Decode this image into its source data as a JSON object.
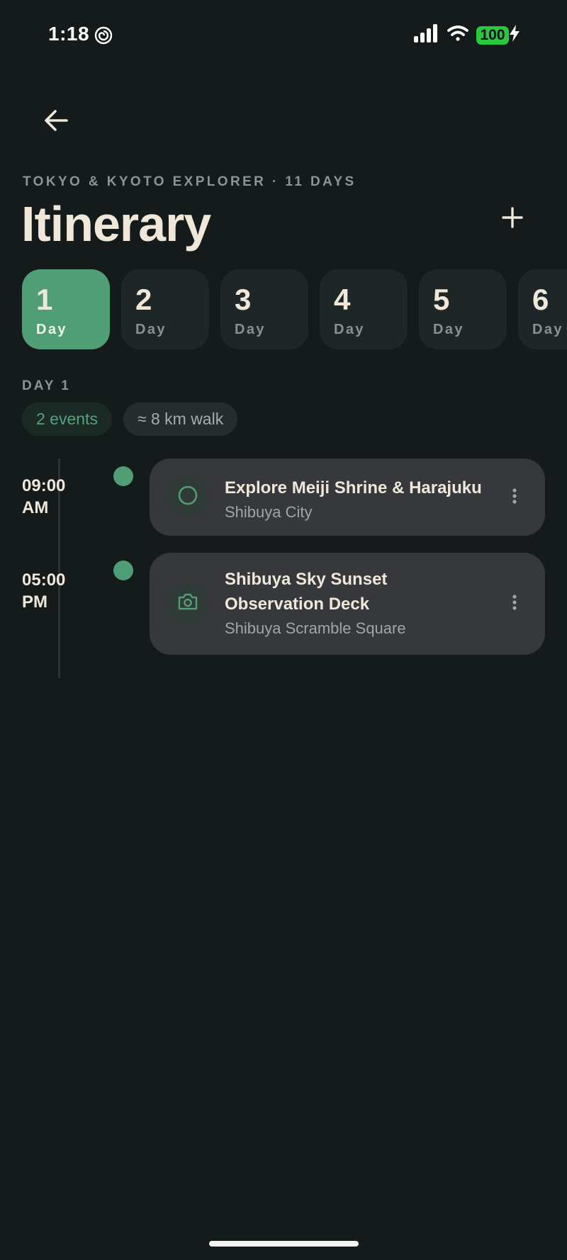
{
  "status_bar": {
    "time": "1:18",
    "battery": "100",
    "app_icon": "spiral-notification-icon",
    "icons": [
      "signal-icon",
      "wifi-icon",
      "battery-icon",
      "charging-bolt-icon"
    ]
  },
  "header": {
    "back_icon": "arrow-left-icon",
    "subtitle": "TOKYO & KYOTO EXPLORER · 11 DAYS",
    "title": "Itinerary",
    "add_icon": "plus-icon"
  },
  "days": [
    {
      "number": "1",
      "label": "Day",
      "active": true
    },
    {
      "number": "2",
      "label": "Day",
      "active": false
    },
    {
      "number": "3",
      "label": "Day",
      "active": false
    },
    {
      "number": "4",
      "label": "Day",
      "active": false
    },
    {
      "number": "5",
      "label": "Day",
      "active": false
    },
    {
      "number": "6",
      "label": "Day",
      "active": false
    }
  ],
  "section": {
    "label": "DAY 1",
    "events_chip": "2 events",
    "walk_chip": "≈ 8 km walk"
  },
  "events": [
    {
      "time_line1": "09:00",
      "time_line2": "AM",
      "title": "Explore Meiji Shrine & Harajuku",
      "location": "Shibuya City",
      "icon": "circle-outline-icon"
    },
    {
      "time_line1": "05:00",
      "time_line2": "PM",
      "title": "Shibuya Sky Sunset Observation Deck",
      "location": "Shibuya Scramble Square",
      "icon": "camera-icon"
    }
  ],
  "colors": {
    "background": "#151a1b",
    "accent": "#4f9e76",
    "card": "#37383c",
    "text": "#efe7da",
    "muted": "#8e9394",
    "battery": "#27c93f"
  }
}
